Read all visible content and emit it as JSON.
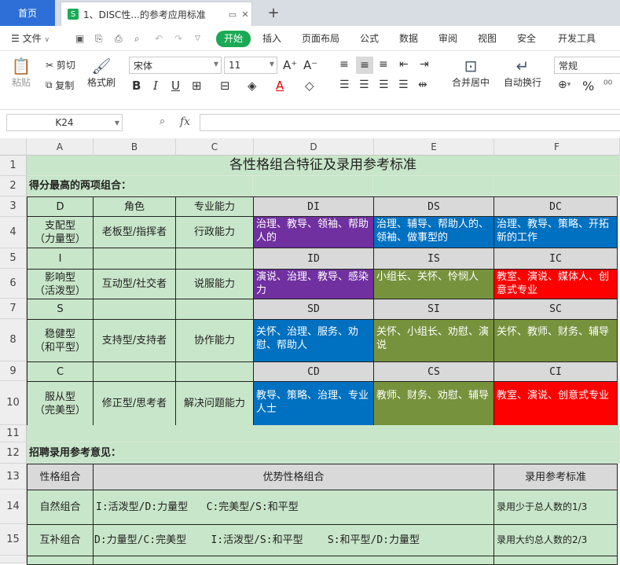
{
  "tabs": {
    "home": "首页",
    "file_icon": "S",
    "file_title": "1、DISC性...的参考应用标准",
    "new_tab": "+"
  },
  "menu": {
    "file": "文件",
    "items": [
      "开始",
      "插入",
      "页面布局",
      "公式",
      "数据",
      "审阅",
      "视图",
      "安全",
      "开发工具"
    ]
  },
  "ribbon": {
    "paste": "粘贴",
    "cut": "剪切",
    "copy": "复制",
    "format_painter": "格式刷",
    "font_name": "宋体",
    "font_size": "11",
    "grow": "A⁺",
    "shrink": "A⁻",
    "merge": "合并居中",
    "wrap": "自动换行",
    "number_format": "常规",
    "currency": "¥",
    "percent": "%"
  },
  "formula_bar": {
    "name_box": "K24",
    "fx": "fx",
    "value": ""
  },
  "columns": [
    "A",
    "B",
    "C",
    "D",
    "E",
    "F"
  ],
  "rows": [
    "1",
    "2",
    "3",
    "4",
    "5",
    "6",
    "7",
    "8",
    "9",
    "10",
    "11",
    "12",
    "13",
    "14",
    "15"
  ],
  "sheet": {
    "title": "各性格组合特征及录用参考标准",
    "section1": "得分最高的两项组合：",
    "section2": "招聘录用参考意见：",
    "r3": [
      "D",
      "角色",
      "专业能力",
      "DI",
      "DS",
      "DC"
    ],
    "r4": [
      "支配型\n（力量型）",
      "老板型/指挥者",
      "行政能力",
      "治理、教导、领袖、帮助人的",
      "治理、辅导、帮助人的、领袖、做事型的",
      "治理、教导、策略、开拓新的工作"
    ],
    "r5": [
      "I",
      "",
      "",
      "ID",
      "IS",
      "IC"
    ],
    "r6": [
      "影响型\n（活泼型）",
      "互动型/社交者",
      "说服能力",
      "演说、治理、教导、感染力",
      "小组长、关怀、怜悯人",
      "教室、演说、媒体人、创意式专业"
    ],
    "r7": [
      "S",
      "",
      "",
      "SD",
      "SI",
      "SC"
    ],
    "r8": [
      "稳健型\n（和平型）",
      "支持型/支持者",
      "协作能力",
      "关怀、治理、服务、劝慰、帮助人",
      "关怀、小组长、劝慰、演说",
      "关怀、教师、财务、辅导"
    ],
    "r9": [
      "C",
      "",
      "",
      "CD",
      "CS",
      "CI"
    ],
    "r10": [
      "服从型\n（完美型）",
      "修正型/思考者",
      "解决问题能力",
      "教导、策略、治理、专业人士",
      "教师、财务、劝慰、辅导",
      "教室、演说、创意式专业"
    ],
    "r13": [
      "性格组合",
      "优势性格组合",
      "录用参考标准"
    ],
    "r14": [
      "自然组合",
      "I:活泼型/D:力量型   C:完美型/S:和平型",
      "录用少于总人数的1/3"
    ],
    "r15": [
      "互补组合",
      "D:力量型/C:完美型    I:活泼型/S:和平型    S:和平型/D:力量型",
      "录用大约总人数的2/3"
    ]
  },
  "colors": {
    "purple": "#7030a0",
    "blue": "#0070c0",
    "olive": "#76923c",
    "red": "#ff0000",
    "green_fill": "#c8e6c9",
    "accent": "#1aaa55"
  }
}
